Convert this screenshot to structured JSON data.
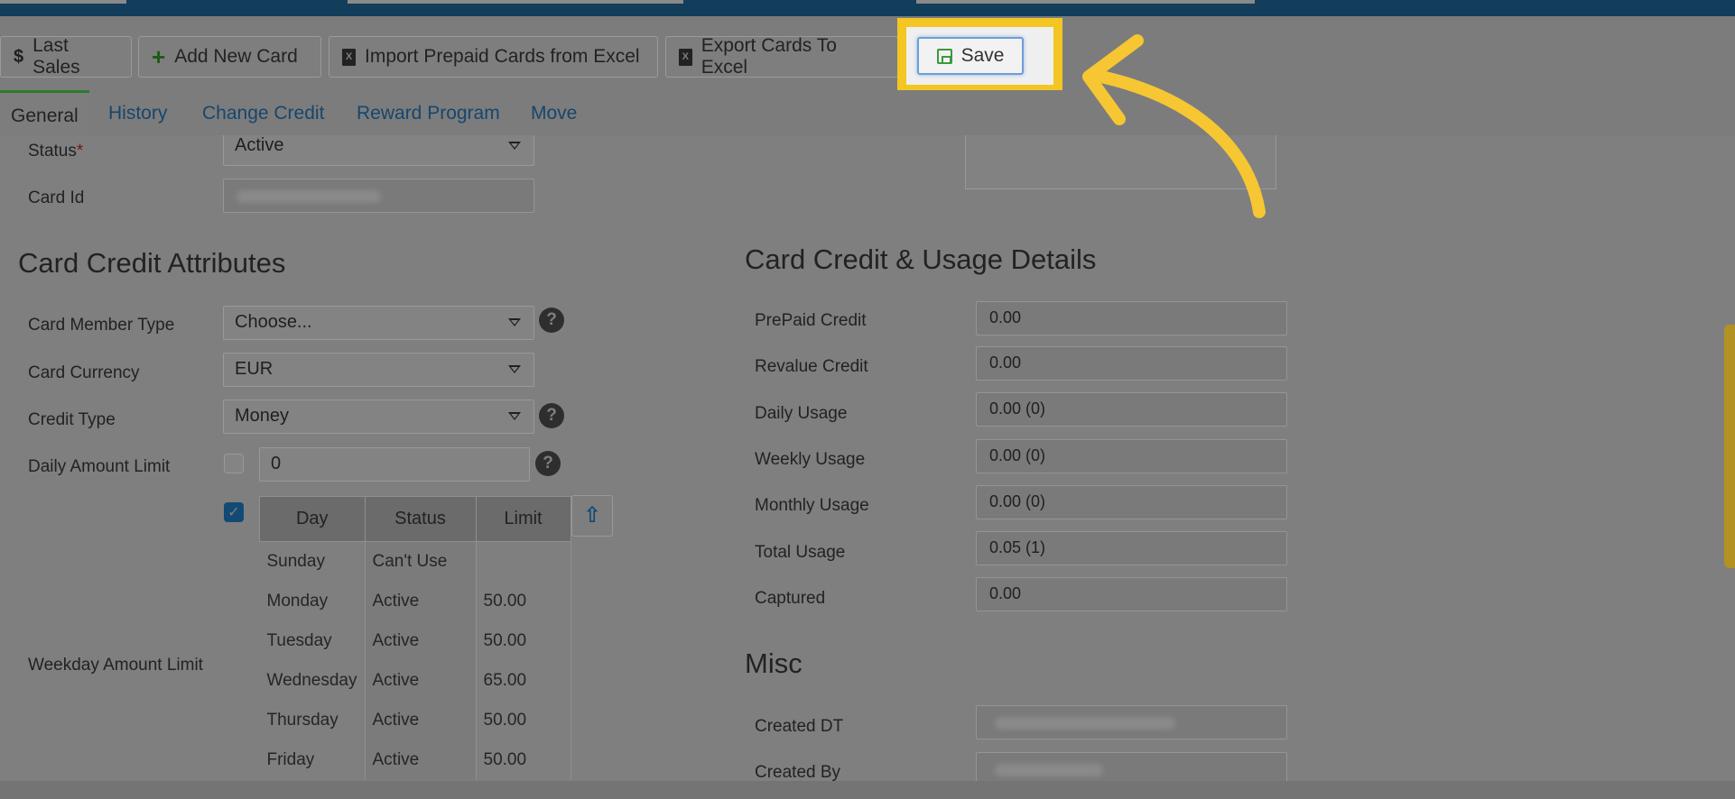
{
  "toolbar": {
    "last_sales": "Last Sales",
    "add_new_card": "Add New Card",
    "import_excel": "Import Prepaid Cards from Excel",
    "export_excel": "Export Cards To Excel",
    "save": "Save",
    "highlight_color": "#f3c623"
  },
  "tabs": [
    "General",
    "History",
    "Change Credit",
    "Reward Program",
    "Move"
  ],
  "general": {
    "status_label": "Status",
    "status_required": "*",
    "status_value": "Active",
    "card_id_label": "Card Id"
  },
  "credit_attributes": {
    "heading": "Card Credit Attributes",
    "member_type_label": "Card Member Type",
    "member_type_value": "Choose...",
    "currency_label": "Card Currency",
    "currency_value": "EUR",
    "credit_type_label": "Credit Type",
    "credit_type_value": "Money",
    "daily_limit_label": "Daily Amount Limit",
    "daily_limit_value": "0",
    "weekday_limit_label": "Weekday Amount Limit",
    "weekday_table": {
      "headers": [
        "Day",
        "Status",
        "Limit"
      ],
      "rows": [
        {
          "day": "Sunday",
          "status": "Can't Use",
          "limit": ""
        },
        {
          "day": "Monday",
          "status": "Active",
          "limit": "50.00"
        },
        {
          "day": "Tuesday",
          "status": "Active",
          "limit": "50.00"
        },
        {
          "day": "Wednesday",
          "status": "Active",
          "limit": "65.00"
        },
        {
          "day": "Thursday",
          "status": "Active",
          "limit": "50.00"
        },
        {
          "day": "Friday",
          "status": "Active",
          "limit": "50.00"
        }
      ]
    }
  },
  "usage": {
    "heading": "Card Credit & Usage Details",
    "prepaid_label": "PrePaid Credit",
    "prepaid_value": "0.00",
    "revalue_label": "Revalue Credit",
    "revalue_value": "0.00",
    "daily_label": "Daily Usage",
    "daily_value": "0.00 (0)",
    "weekly_label": "Weekly Usage",
    "weekly_value": "0.00 (0)",
    "monthly_label": "Monthly Usage",
    "monthly_value": "0.00 (0)",
    "total_label": "Total Usage",
    "total_value": "0.05 (1)",
    "captured_label": "Captured",
    "captured_value": "0.00"
  },
  "misc": {
    "heading": "Misc",
    "created_dt_label": "Created DT",
    "created_by_label": "Created By"
  }
}
